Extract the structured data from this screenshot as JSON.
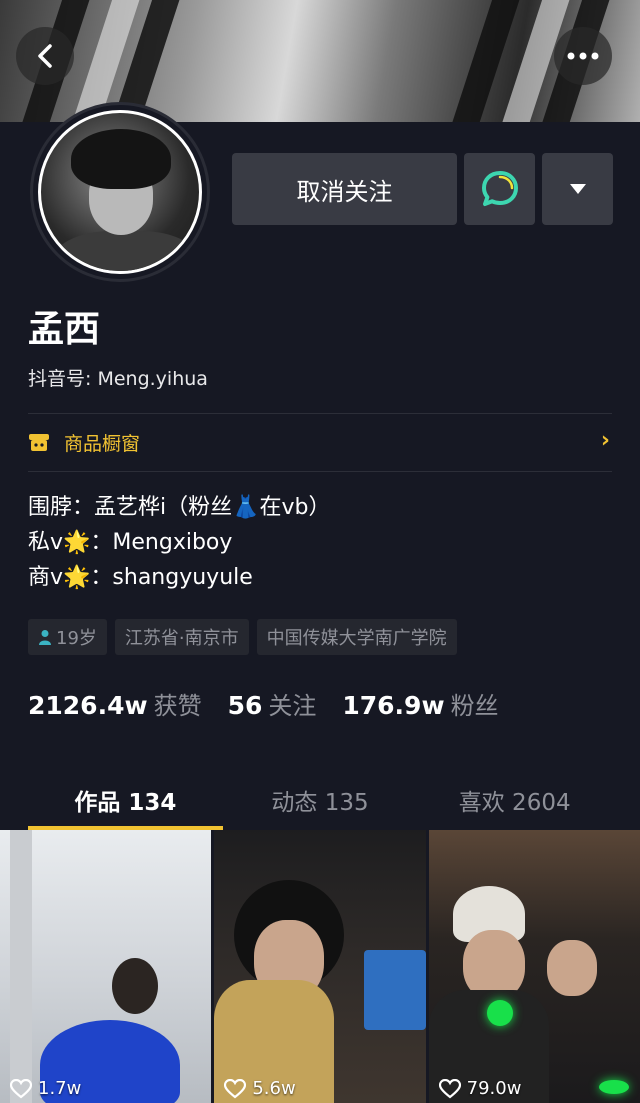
{
  "header": {
    "back_icon": "chevron-left-icon",
    "more_icon": "more-dots-icon"
  },
  "profile": {
    "name": "孟西",
    "douyin_id_label": "抖音号:",
    "douyin_id": "Meng.yihua"
  },
  "actions": {
    "unfollow_label": "取消关注",
    "message_icon": "chat-bubble-icon",
    "dropdown_icon": "caret-down-icon"
  },
  "shop": {
    "label": "商品橱窗",
    "icon": "shop-icon",
    "arrow_icon": "chevron-right-icon"
  },
  "bio": [
    "围脖：孟艺桦i（粉丝👗在vb）",
    "私v🌟：Mengxiboy",
    "商v🌟：shangyuyule"
  ],
  "tags": [
    {
      "label": "19岁",
      "icon": "male-icon"
    },
    {
      "label": "江苏省·南京市"
    },
    {
      "label": "中国传媒大学南广学院"
    }
  ],
  "stats": [
    {
      "value": "2126.4w",
      "label": "获赞"
    },
    {
      "value": "56",
      "label": "关注"
    },
    {
      "value": "176.9w",
      "label": "粉丝"
    }
  ],
  "tabs": [
    {
      "label": "作品 134",
      "active": true
    },
    {
      "label": "动态 135",
      "active": false
    },
    {
      "label": "喜欢 2604",
      "active": false
    }
  ],
  "videos": [
    {
      "likes": "1.7w"
    },
    {
      "likes": "5.6w"
    },
    {
      "likes": "79.0w"
    }
  ],
  "colors": {
    "accent": "#f1c232",
    "background": "#161823",
    "button": "#393b44",
    "message": "#3dd6b0"
  }
}
